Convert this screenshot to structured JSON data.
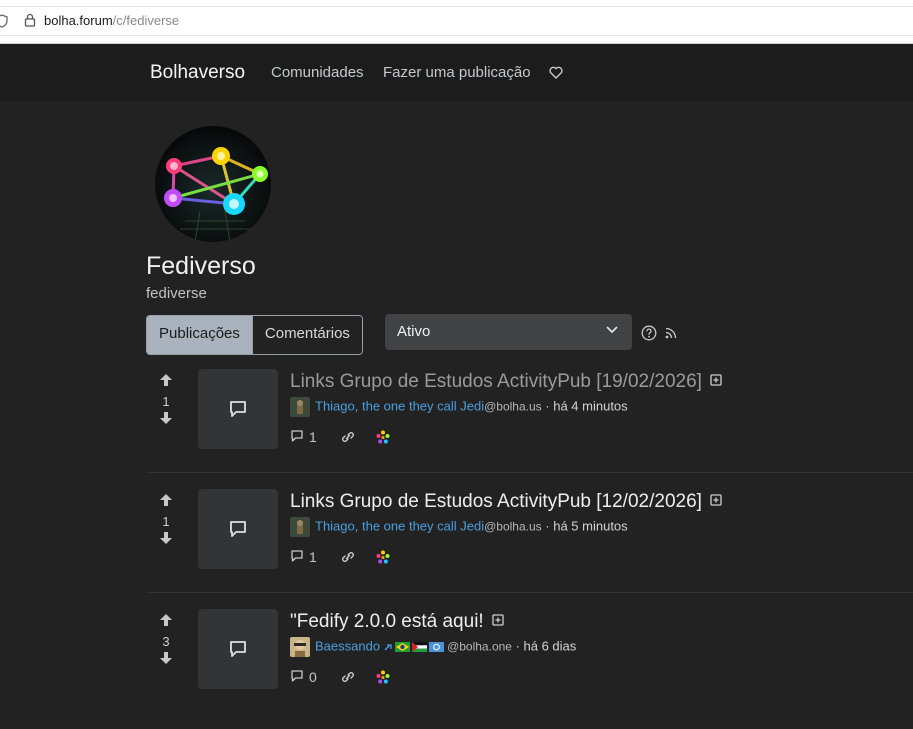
{
  "browser": {
    "url_host": "bolha.forum",
    "url_path": "/c/fediverse"
  },
  "nav": {
    "brand": "Bolhaverso",
    "links": [
      "Comunidades",
      "Fazer uma publicação"
    ]
  },
  "community": {
    "title": "Fediverso",
    "name": "fediverse"
  },
  "tabs": [
    "Publicações",
    "Comentários"
  ],
  "sort": {
    "selected": "Ativo"
  },
  "posts": [
    {
      "score": "1",
      "title": "Links Grupo de Estudos ActivityPub [19/02/2026]",
      "author": "Thiago, the one they call Jedi",
      "instance": "@bolha.us",
      "time": " · há 4 minutos",
      "comments": "1",
      "read": true
    },
    {
      "score": "1",
      "title": "Links Grupo de Estudos ActivityPub [12/02/2026]",
      "author": "Thiago, the one they call Jedi",
      "instance": "@bolha.us",
      "time": " · há 5 minutos",
      "comments": "1",
      "read": false
    },
    {
      "score": "3",
      "title": "\"Fedify 2.0.0 está aqui!",
      "author": "Baessando",
      "instance": "@bolha.one",
      "time": " · há 6 dias",
      "comments": "0",
      "read": false
    }
  ],
  "colors": {
    "background": "#222222",
    "nav": "#1c1c1c",
    "author_link": "#4a9fe0",
    "active_tab": "#a9b2bd"
  }
}
